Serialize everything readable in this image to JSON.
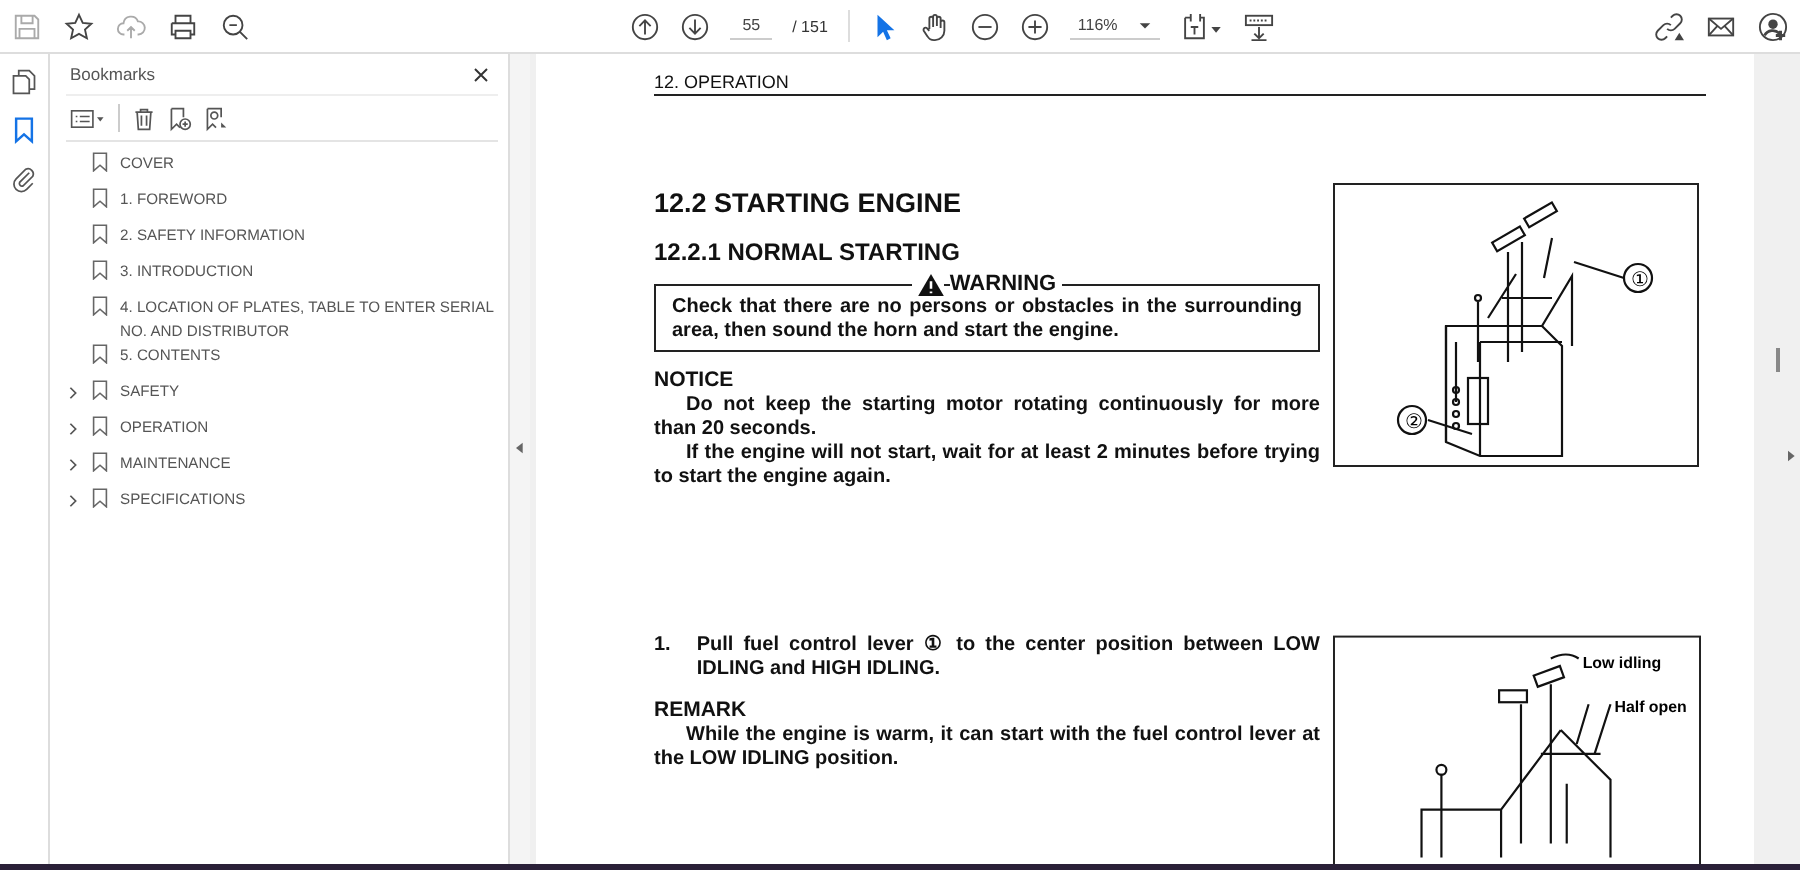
{
  "toolbar": {
    "page_number": "55",
    "page_total": "/ 151",
    "zoom": "116%",
    "tools": [
      {
        "kind": "select",
        "selected": true
      },
      {
        "kind": "hand",
        "selected": false
      }
    ]
  },
  "side_rail": [
    {
      "kind": "pages",
      "selected": false
    },
    {
      "kind": "bookmarks",
      "selected": true
    },
    {
      "kind": "attachments",
      "selected": false
    }
  ],
  "bookmarks": {
    "title": "Bookmarks",
    "items": [
      {
        "label": "COVER",
        "kind": "leaf"
      },
      {
        "label": "1. FOREWORD",
        "kind": "leaf"
      },
      {
        "label": "2. SAFETY INFORMATION",
        "kind": "leaf"
      },
      {
        "label": "3. INTRODUCTION",
        "kind": "leaf"
      },
      {
        "label": "4. LOCATION OF PLATES, TABLE TO ENTER SERIAL NO. AND DISTRIBUTOR",
        "kind": "leaf"
      },
      {
        "label": "5. CONTENTS",
        "kind": "leaf"
      },
      {
        "label": "SAFETY",
        "kind": "folder",
        "expanded": false
      },
      {
        "label": "OPERATION",
        "kind": "folder",
        "expanded": false
      },
      {
        "label": "MAINTENANCE",
        "kind": "folder",
        "expanded": false
      },
      {
        "label": "SPECIFICATIONS",
        "kind": "folder",
        "expanded": false
      }
    ]
  },
  "document": {
    "running_head": "12. OPERATION",
    "heading": "12.2  STARTING ENGINE",
    "subheading": "12.2.1 NORMAL STARTING",
    "warning": {
      "title": "WARNING",
      "text": "Check that there are no persons or obstacles in the surrounding area, then sound the horn and start the engine."
    },
    "notice": {
      "title": "NOTICE",
      "paragraphs": [
        "Do not keep the starting motor rotating continuously for more than 20 seconds.",
        "If the engine will not start, wait for at least 2 minutes before trying to start the engine again."
      ]
    },
    "figure_1": {
      "callouts": [
        "①",
        "②"
      ]
    },
    "step": {
      "number": "1.",
      "text": "Pull fuel control lever ① to the center position between LOW IDLING and HIGH IDLING."
    },
    "remark": {
      "title": "REMARK",
      "text": "While the engine is warm, it can start with the fuel control lever at the LOW IDLING position."
    },
    "figure_2": {
      "callouts": [
        "Low idling",
        "Half open"
      ]
    }
  }
}
